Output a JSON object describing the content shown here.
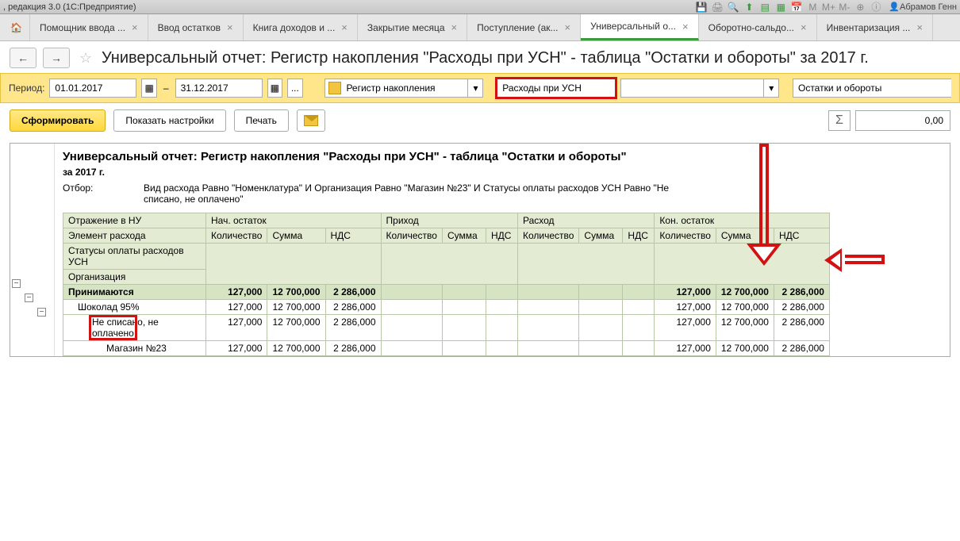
{
  "titlebar": {
    "left": ", редакция 3.0  (1С:Предприятие)",
    "user": "Абрамов Генн"
  },
  "tabs": [
    {
      "label": "Помощник ввода ...",
      "active": false
    },
    {
      "label": "Ввод остатков",
      "active": false
    },
    {
      "label": "Книга доходов и ...",
      "active": false
    },
    {
      "label": "Закрытие месяца",
      "active": false
    },
    {
      "label": "Поступление (ак...",
      "active": false
    },
    {
      "label": "Универсальный о...",
      "active": true
    },
    {
      "label": "Оборотно-сальдо...",
      "active": false
    },
    {
      "label": "Инвентаризация ...",
      "active": false
    }
  ],
  "page_title": "Универсальный отчет: Регистр накопления \"Расходы при УСН\" - таблица \"Остатки и обороты\" за 2017 г.",
  "period": {
    "label": "Период:",
    "from": "01.01.2017",
    "to": "31.12.2017",
    "ellipsis": "...",
    "source_type": "Регистр накопления",
    "register": "Расходы при УСН",
    "register_side": "",
    "analysis": "Остатки и обороты"
  },
  "actions": {
    "form": "Сформировать",
    "settings": "Показать настройки",
    "print": "Печать"
  },
  "sum": {
    "sigma": "Σ",
    "value": "0,00"
  },
  "report": {
    "title": "Универсальный отчет: Регистр накопления \"Расходы при УСН\" - таблица \"Остатки и обороты\"",
    "subtitle": "за 2017 г.",
    "filter_label": "Отбор:",
    "filter_value": "Вид расхода Равно \"Номенклатура\" И Организация Равно \"Магазин №23\" И Статусы оплаты расходов УСН Равно \"Не списано, не оплачено\"",
    "header_rows": [
      "Отражение в НУ",
      "Элемент расхода",
      "Статусы оплаты расходов УСН",
      "Организация"
    ],
    "groups": {
      "nach": "Нач. остаток",
      "prihod": "Приход",
      "rashod": "Расход",
      "kon": "Кон. остаток"
    },
    "subcols": {
      "qty": "Количество",
      "sum": "Сумма",
      "vat": "НДС"
    },
    "rows": [
      {
        "label": "Принимаются",
        "level": 0,
        "total": true,
        "nach_qty": "127,000",
        "nach_sum": "12 700,000",
        "nach_vat": "2 286,000",
        "kon_qty": "127,000",
        "kon_sum": "12 700,000",
        "kon_vat": "2 286,000"
      },
      {
        "label": "Шоколад 95%",
        "level": 1,
        "nach_qty": "127,000",
        "nach_sum": "12 700,000",
        "nach_vat": "2 286,000",
        "kon_qty": "127,000",
        "kon_sum": "12 700,000",
        "kon_vat": "2 286,000"
      },
      {
        "label": "Не списано, не оплачено",
        "level": 2,
        "highlight": true,
        "nach_qty": "127,000",
        "nach_sum": "12 700,000",
        "nach_vat": "2 286,000",
        "kon_qty": "127,000",
        "kon_sum": "12 700,000",
        "kon_vat": "2 286,000"
      },
      {
        "label": "Магазин №23",
        "level": 3,
        "nach_qty": "127,000",
        "nach_sum": "12 700,000",
        "nach_vat": "2 286,000",
        "kon_qty": "127,000",
        "kon_sum": "12 700,000",
        "kon_vat": "2 286,000"
      }
    ]
  }
}
